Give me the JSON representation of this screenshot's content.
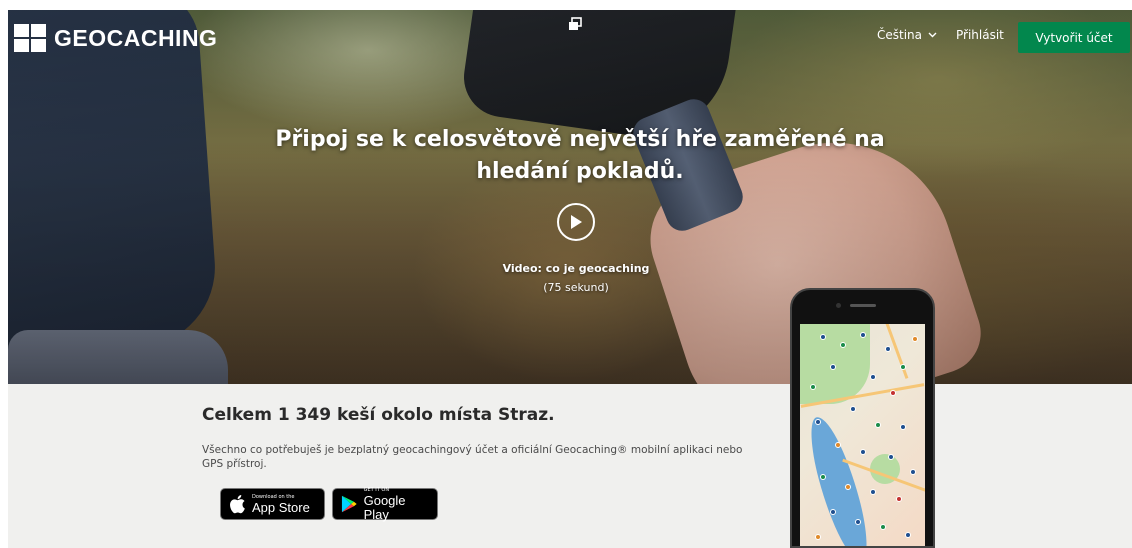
{
  "header": {
    "logo_text": "GEOCACHING",
    "language": "Čeština",
    "login": "Přihlásit",
    "signup": "Vytvořit účet"
  },
  "hero": {
    "headline": "Připoj se k celosvětově největší hře zaměřené na hledání pokladů.",
    "video_title": "Video: co je geocaching",
    "video_duration": "(75 sekund)"
  },
  "info": {
    "count": "Celkem 1 349 keší okolo místa Straz.",
    "description": "Všechno co potřebuješ je bezplatný geocachingový účet a oficiální Geocaching® mobilní aplikaci nebo GPS přístroj."
  },
  "stores": {
    "apple_small": "Download on the",
    "apple_big": "App Store",
    "google_small": "GET IT ON",
    "google_big": "Google Play"
  },
  "colors": {
    "accent": "#02874d"
  }
}
